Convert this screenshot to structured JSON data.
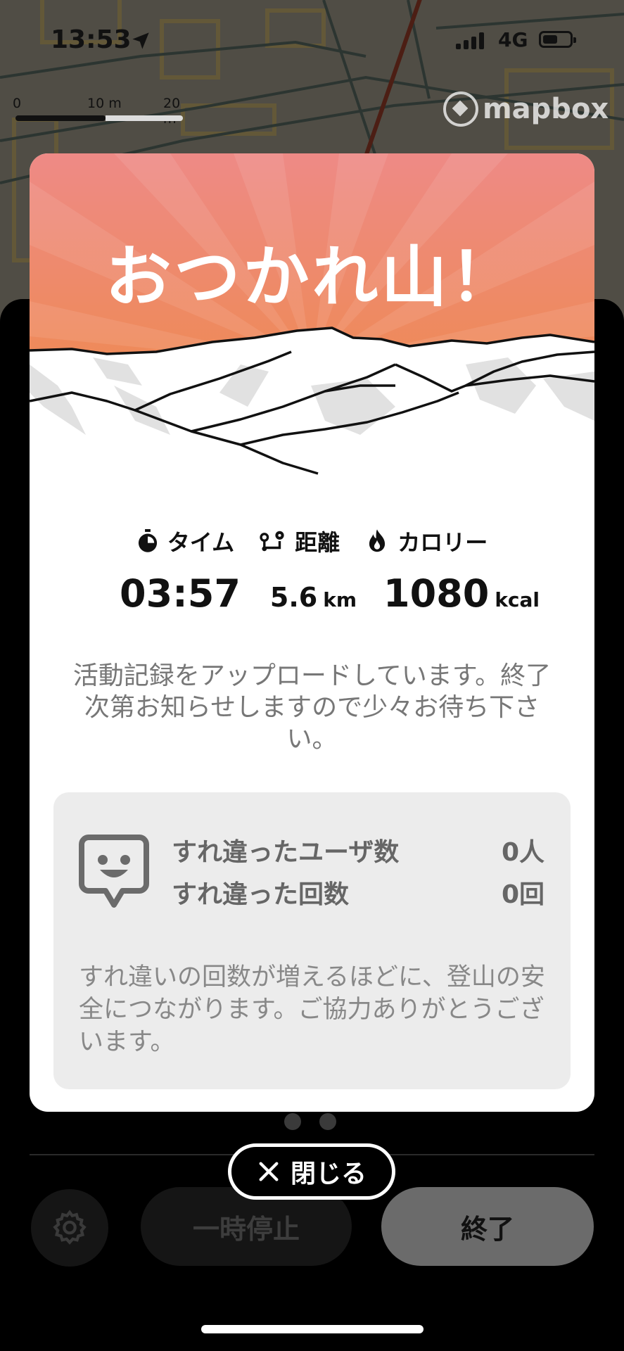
{
  "status_bar": {
    "time": "13:53",
    "network": "4G"
  },
  "map": {
    "scale_labels": [
      "0",
      "10 m",
      "20 m"
    ],
    "attribution": "mapbox"
  },
  "modal": {
    "title": "おつかれ山！",
    "stats": {
      "time_label": "タイム",
      "distance_label": "距離",
      "calorie_label": "カロリー",
      "time_value": "03:57",
      "distance_value": "5.6",
      "distance_unit": "km",
      "calorie_value": "1080",
      "calorie_unit": "kcal"
    },
    "upload_message": "活動記録をアップロードしています。終了次第お知らせしますので少々お待ち下さい。",
    "encounter": {
      "users_label": "すれ違ったユーザ数",
      "users_value": "0人",
      "count_label": "すれ違った回数",
      "count_value": "0回",
      "note": "すれ違いの回数が増えるほどに、登山の安全につながります。ご協力ありがとうございます。"
    }
  },
  "close_button": {
    "label": "閉じる"
  },
  "controls": {
    "pause_label": "一時停止",
    "end_label": "終了"
  },
  "colors": {
    "hero_top": "#ee8a86",
    "hero_bottom": "#ef8a3f",
    "card_bg": "#ffffff",
    "panel_bg": "#000000",
    "encounter_bg": "#ececec"
  },
  "icons": [
    "location-arrow-icon",
    "signal-icon",
    "battery-icon",
    "mapbox-logo-icon",
    "stopwatch-icon",
    "route-icon",
    "flame-icon",
    "smiley-speech-icon",
    "close-x-icon",
    "gear-icon"
  ],
  "page_dots": 2
}
